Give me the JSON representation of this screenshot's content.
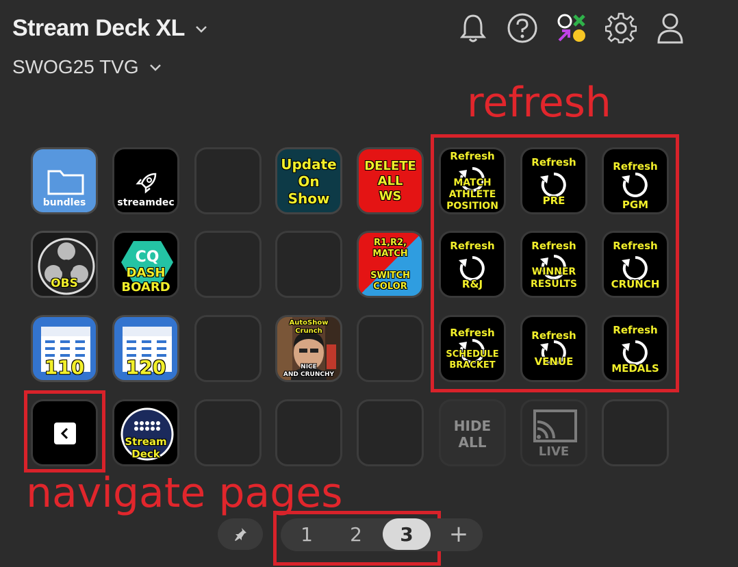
{
  "header": {
    "device": "Stream Deck XL",
    "profile": "SWOG25 TVG"
  },
  "icons": {
    "bell": "bell-icon",
    "help": "help-icon",
    "marketplace": "marketplace-icon",
    "settings": "gear-icon",
    "account": "user-icon"
  },
  "annotations": {
    "refresh": "refresh",
    "navigate": "navigate pages"
  },
  "keys": {
    "bundles": "bundles",
    "streamdeck": "streamdec",
    "update1": "Update",
    "update2": "On",
    "update3": "Show",
    "delete1": "DELETE",
    "delete2": "ALL",
    "delete3": "WS",
    "obs": "OBS",
    "dash1": "DASH",
    "dash2": "BOARD",
    "switch1": "R1,R2,",
    "switch2": "MATCH",
    "switch3": "SWITCH",
    "switch4": "COLOR",
    "cal110": "110",
    "cal120": "120",
    "auto1": "AutoShow",
    "auto2": "Crunch",
    "auto3": "NICE",
    "auto4": "AND CRUNCHY",
    "sd1": "Stream",
    "sd2": "Deck",
    "hide1": "HIDE",
    "hide2": "ALL",
    "live": "LIVE",
    "refresh_word": "Refresh",
    "r_match1": "MATCH",
    "r_match2": "ATHLETE",
    "r_match3": "POSITION",
    "r_pre": "PRE",
    "r_pgm": "PGM",
    "r_rj": "R&J",
    "r_winner1": "WINNER",
    "r_winner2": "RESULTS",
    "r_crunch": "CRUNCH",
    "r_sched1": "SCHEDULE",
    "r_sched2": "BRACKET",
    "r_venue": "VENUE",
    "r_medals": "MEDALS"
  },
  "pages": {
    "p1": "1",
    "p2": "2",
    "p3": "3",
    "add": "+"
  }
}
